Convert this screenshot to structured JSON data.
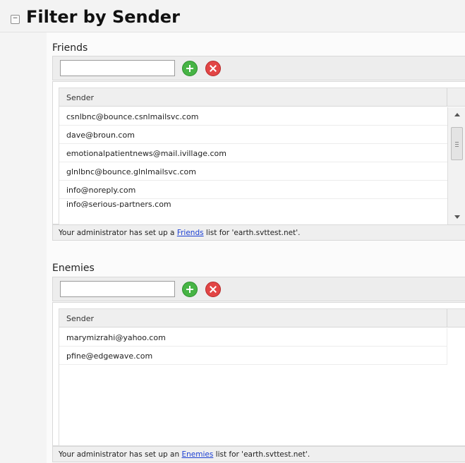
{
  "header": {
    "title": "Filter by Sender",
    "collapse_glyph": "−"
  },
  "friends": {
    "label": "Friends",
    "input_value": "",
    "add_icon": "add-circle-icon",
    "remove_icon": "remove-circle-icon",
    "column_header": "Sender",
    "rows": [
      "csnlbnc@bounce.csnlmailsvc.com",
      "dave@broun.com",
      "emotionalpatientnews@mail.ivillage.com",
      "glnlbnc@bounce.glnlmailsvc.com",
      "info@noreply.com",
      "info@serious-partners.com"
    ],
    "note_prefix": "Your administrator has set up a ",
    "note_link": "Friends",
    "note_suffix": " list for 'earth.svttest.net'."
  },
  "enemies": {
    "label": "Enemies",
    "input_value": "",
    "add_icon": "add-circle-icon",
    "remove_icon": "remove-circle-icon",
    "column_header": "Sender",
    "rows": [
      "marymizrahi@yahoo.com",
      "pfine@edgewave.com"
    ],
    "note_prefix": "Your administrator has set up an ",
    "note_link": "Enemies",
    "note_suffix": " list for 'earth.svttest.net'."
  },
  "colors": {
    "add_green": "#47b445",
    "remove_red": "#e24545",
    "link_blue": "#1b3fd3"
  }
}
